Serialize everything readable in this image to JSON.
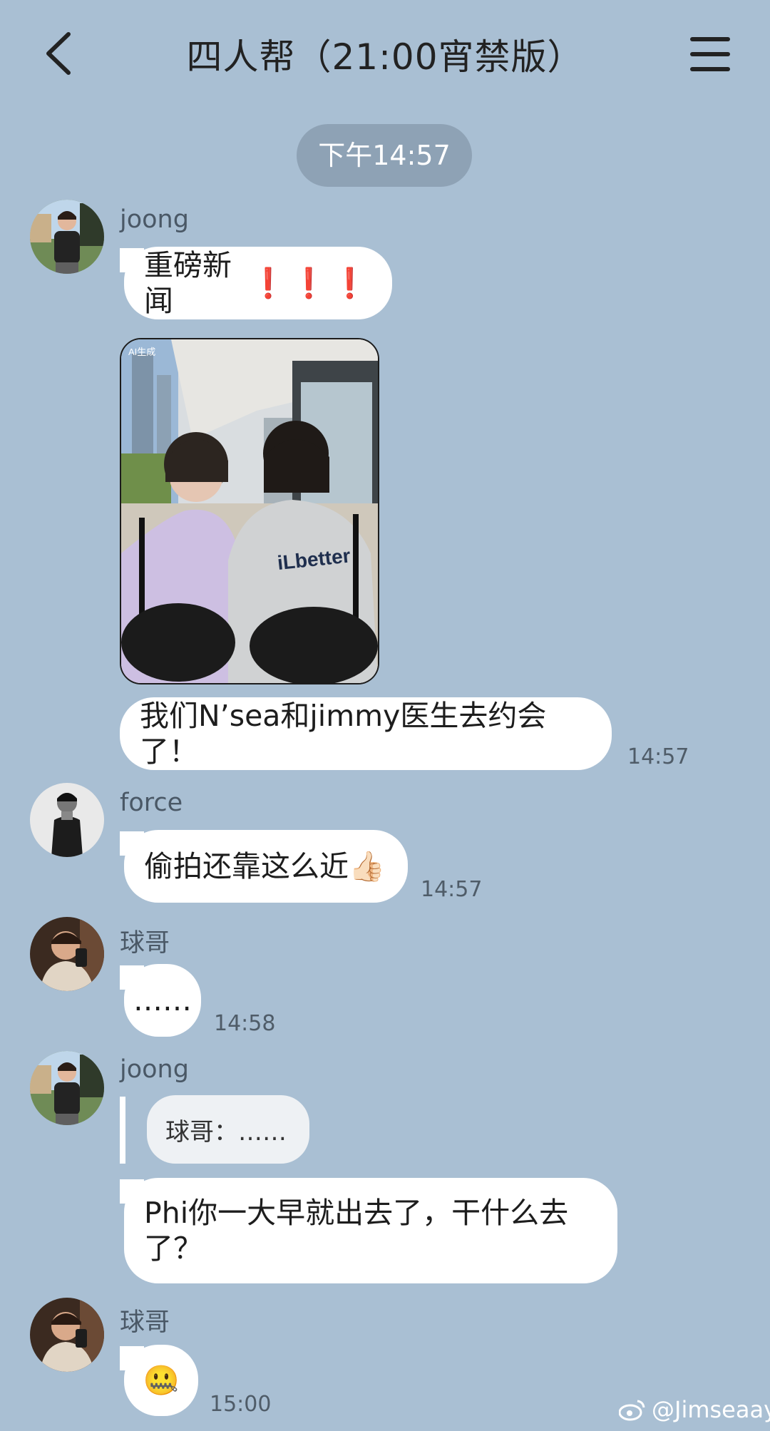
{
  "header": {
    "title": "四人帮（21:00宵禁版）"
  },
  "time_divider": "下午14:57",
  "messages": [
    {
      "sender": "joong",
      "text": "重磅新闻",
      "emoji": "❗❗❗"
    },
    {
      "caption": "我们N’sea和jimmy医生去约会了！",
      "time": "14:57",
      "photo_text": "iLbetter",
      "photo_badge": "AI生成"
    },
    {
      "sender": "force",
      "text": "偷拍还靠这么近👍🏻",
      "time": "14:57"
    },
    {
      "sender": "球哥",
      "text": "……",
      "time": "14:58"
    },
    {
      "sender": "joong",
      "quote": "球哥：……",
      "text_line1": "Phi你一大早就出去了，干什么去",
      "text_line2": "了？"
    },
    {
      "sender": "球哥",
      "emoji": "🤐",
      "time": "15:00"
    }
  ],
  "watermark": "@Jimseaay",
  "colors": {
    "background": "#a9bfd3",
    "bubble": "#ffffff",
    "pill": "#8ea2b5"
  }
}
